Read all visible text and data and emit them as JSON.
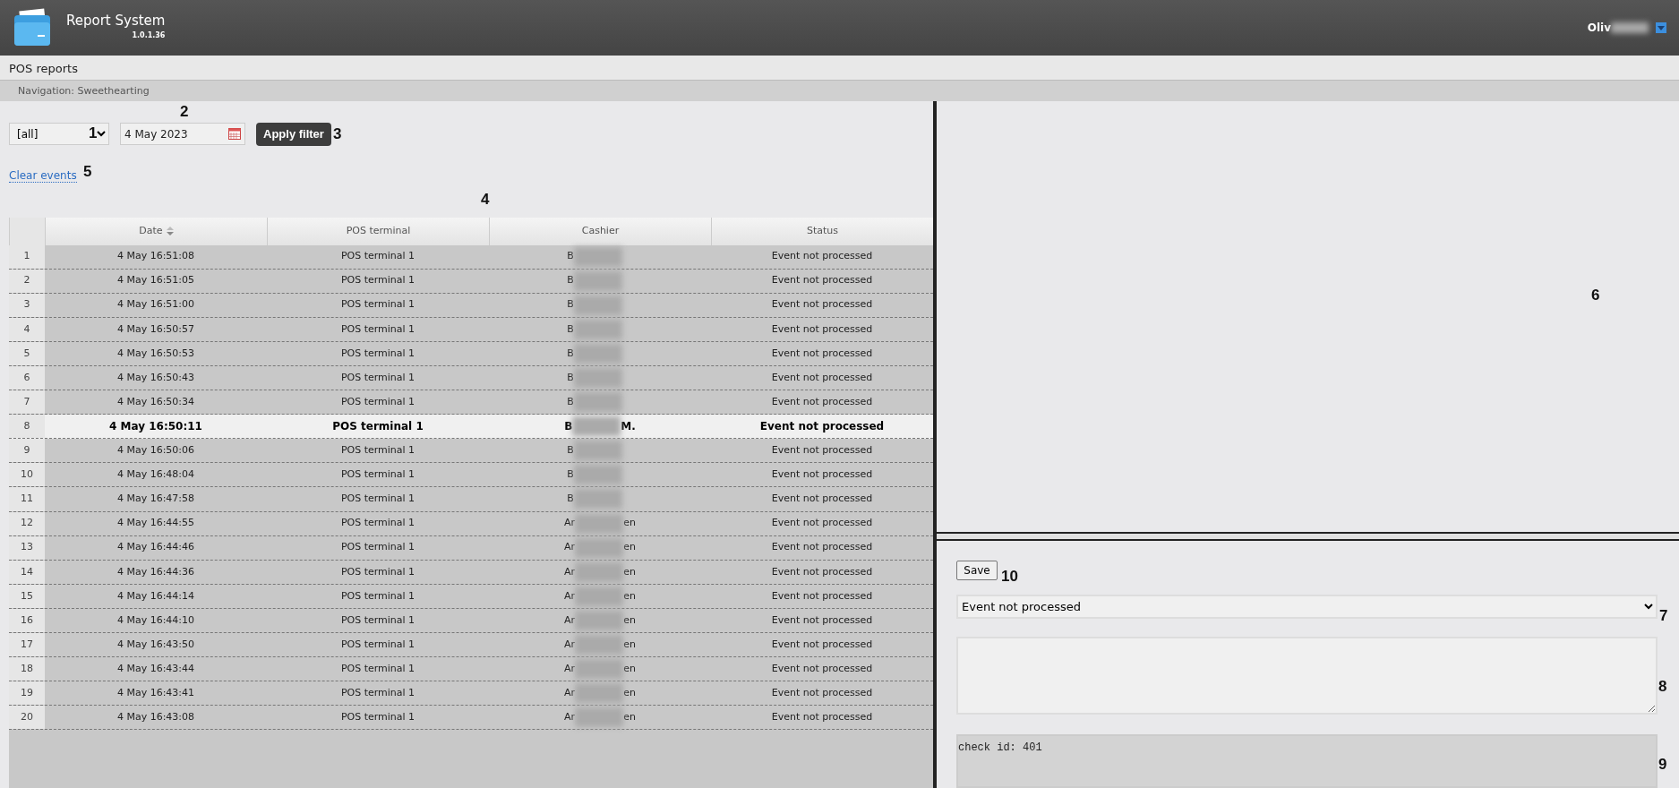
{
  "header": {
    "title": "Report System",
    "version": "1.0.1.36",
    "user_visible": "Oliv"
  },
  "page_title": "POS reports",
  "breadcrumb": "Navigation: Sweethearting",
  "filter": {
    "terminal_select": "[all]",
    "date": "4 May 2023",
    "apply_button": "Apply filter"
  },
  "clear_link": "Clear events",
  "table": {
    "columns": [
      {
        "label": "Date",
        "sorted": true
      },
      {
        "label": "POS terminal",
        "sorted": false
      },
      {
        "label": "Cashier",
        "sorted": false
      },
      {
        "label": "Status",
        "sorted": false
      }
    ],
    "rows": [
      {
        "index": "1",
        "date": "4 May 16:51:08",
        "terminal": "POS terminal 1",
        "cashier_start": "B",
        "cashier_end": "",
        "status": "Event not processed",
        "selected": false
      },
      {
        "index": "2",
        "date": "4 May 16:51:05",
        "terminal": "POS terminal 1",
        "cashier_start": "B",
        "cashier_end": "",
        "status": "Event not processed",
        "selected": false
      },
      {
        "index": "3",
        "date": "4 May 16:51:00",
        "terminal": "POS terminal 1",
        "cashier_start": "B",
        "cashier_end": "",
        "status": "Event not processed",
        "selected": false
      },
      {
        "index": "4",
        "date": "4 May 16:50:57",
        "terminal": "POS terminal 1",
        "cashier_start": "B",
        "cashier_end": "",
        "status": "Event not processed",
        "selected": false
      },
      {
        "index": "5",
        "date": "4 May 16:50:53",
        "terminal": "POS terminal 1",
        "cashier_start": "B",
        "cashier_end": "",
        "status": "Event not processed",
        "selected": false
      },
      {
        "index": "6",
        "date": "4 May 16:50:43",
        "terminal": "POS terminal 1",
        "cashier_start": "B",
        "cashier_end": "",
        "status": "Event not processed",
        "selected": false
      },
      {
        "index": "7",
        "date": "4 May 16:50:34",
        "terminal": "POS terminal 1",
        "cashier_start": "B",
        "cashier_end": "",
        "status": "Event not processed",
        "selected": false
      },
      {
        "index": "8",
        "date": "4 May 16:50:11",
        "terminal": "POS terminal 1",
        "cashier_start": "B",
        "cashier_end": "M.",
        "status": "Event not processed",
        "selected": true
      },
      {
        "index": "9",
        "date": "4 May 16:50:06",
        "terminal": "POS terminal 1",
        "cashier_start": "B",
        "cashier_end": "",
        "status": "Event not processed",
        "selected": false
      },
      {
        "index": "10",
        "date": "4 May 16:48:04",
        "terminal": "POS terminal 1",
        "cashier_start": "B",
        "cashier_end": "",
        "status": "Event not processed",
        "selected": false
      },
      {
        "index": "11",
        "date": "4 May 16:47:58",
        "terminal": "POS terminal 1",
        "cashier_start": "B",
        "cashier_end": "",
        "status": "Event not processed",
        "selected": false
      },
      {
        "index": "12",
        "date": "4 May 16:44:55",
        "terminal": "POS terminal 1",
        "cashier_start": "Ar",
        "cashier_end": "en",
        "status": "Event not processed",
        "selected": false
      },
      {
        "index": "13",
        "date": "4 May 16:44:46",
        "terminal": "POS terminal 1",
        "cashier_start": "Ar",
        "cashier_end": "en",
        "status": "Event not processed",
        "selected": false
      },
      {
        "index": "14",
        "date": "4 May 16:44:36",
        "terminal": "POS terminal 1",
        "cashier_start": "Ar",
        "cashier_end": "en",
        "status": "Event not processed",
        "selected": false
      },
      {
        "index": "15",
        "date": "4 May 16:44:14",
        "terminal": "POS terminal 1",
        "cashier_start": "Ar",
        "cashier_end": "en",
        "status": "Event not processed",
        "selected": false
      },
      {
        "index": "16",
        "date": "4 May 16:44:10",
        "terminal": "POS terminal 1",
        "cashier_start": "Ar",
        "cashier_end": "en",
        "status": "Event not processed",
        "selected": false
      },
      {
        "index": "17",
        "date": "4 May 16:43:50",
        "terminal": "POS terminal 1",
        "cashier_start": "Ar",
        "cashier_end": "en",
        "status": "Event not processed",
        "selected": false
      },
      {
        "index": "18",
        "date": "4 May 16:43:44",
        "terminal": "POS terminal 1",
        "cashier_start": "Ar",
        "cashier_end": "en",
        "status": "Event not processed",
        "selected": false
      },
      {
        "index": "19",
        "date": "4 May 16:43:41",
        "terminal": "POS terminal 1",
        "cashier_start": "Ar",
        "cashier_end": "en",
        "status": "Event not processed",
        "selected": false
      },
      {
        "index": "20",
        "date": "4 May 16:43:08",
        "terminal": "POS terminal 1",
        "cashier_start": "Ar",
        "cashier_end": "en",
        "status": "Event not processed",
        "selected": false
      }
    ]
  },
  "detail": {
    "save_button": "Save",
    "status_select": "Event not processed",
    "check_text": "check id: 401"
  },
  "callouts": [
    "1",
    "2",
    "3",
    "4",
    "5",
    "6",
    "7",
    "8",
    "9",
    "10"
  ]
}
